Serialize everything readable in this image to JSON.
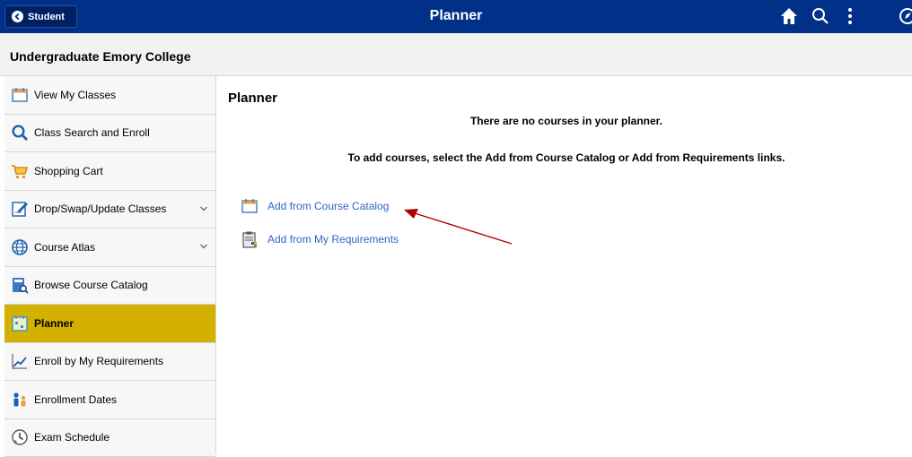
{
  "header": {
    "back_label": "Student",
    "title": "Planner",
    "bg_color": "#003087",
    "icons": [
      "home-icon",
      "search-icon",
      "more-vertical-icon",
      "navigator-icon"
    ]
  },
  "subheader": {
    "college": "Undergraduate Emory College"
  },
  "sidebar": {
    "items": [
      {
        "label": "View My Classes",
        "icon": "calendar-icon"
      },
      {
        "label": "Class Search and Enroll",
        "icon": "search-icon"
      },
      {
        "label": "Shopping Cart",
        "icon": "cart-icon"
      },
      {
        "label": "Drop/Swap/Update Classes",
        "icon": "edit-form-icon",
        "expandable": true
      },
      {
        "label": "Course Atlas",
        "icon": "globe-icon",
        "expandable": true
      },
      {
        "label": "Browse Course Catalog",
        "icon": "catalog-icon"
      },
      {
        "label": "Planner",
        "icon": "planner-icon",
        "active": true
      },
      {
        "label": "Enroll by My Requirements",
        "icon": "chart-line-icon"
      },
      {
        "label": "Enrollment Dates",
        "icon": "people-icon"
      },
      {
        "label": "Exam Schedule",
        "icon": "clock-icon"
      }
    ],
    "active_color": "#d4b000"
  },
  "main": {
    "title": "Planner",
    "message_empty": "There are no courses in your planner.",
    "message_instructions": "To add courses, select the Add from Course Catalog or Add from Requirements links.",
    "links": [
      {
        "label": "Add from Course Catalog",
        "icon": "calendar-icon"
      },
      {
        "label": "Add from My Requirements",
        "icon": "clipboard-icon"
      }
    ],
    "link_color": "#2f64c7",
    "annotation_arrow_color": "#b00000"
  }
}
